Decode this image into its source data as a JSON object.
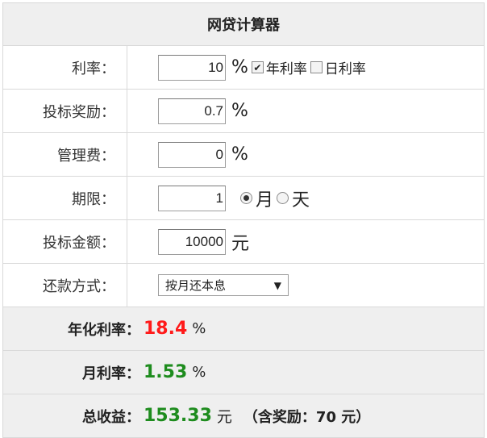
{
  "title": "网贷计算器",
  "rows": {
    "rate": {
      "label": "利率：",
      "value": "10",
      "unit": "%",
      "annual_label": "年利率",
      "daily_label": "日利率",
      "annual_checked": true,
      "daily_checked": false
    },
    "bonus": {
      "label": "投标奖励：",
      "value": "0.7",
      "unit": "%"
    },
    "fee": {
      "label": "管理费：",
      "value": "0",
      "unit": "%"
    },
    "term": {
      "label": "期限：",
      "value": "1",
      "month_label": "月",
      "day_label": "天",
      "selected": "月"
    },
    "amount": {
      "label": "投标金额：",
      "value": "10000",
      "unit": "元"
    },
    "repay": {
      "label": "还款方式：",
      "selected": "按月还本息"
    }
  },
  "results": {
    "annual": {
      "label": "年化利率：",
      "value": "18.4",
      "unit": "%"
    },
    "monthly": {
      "label": "月利率：",
      "value": "1.53",
      "unit": "%"
    },
    "total": {
      "label": "总收益：",
      "value": "153.33",
      "unit": "元",
      "bonus_note": "（含奖励：70 元）"
    }
  },
  "colors": {
    "accent_red": "#ff1a1a",
    "accent_green": "#1e8c1e",
    "panel_bg": "#efefef",
    "border": "#d9d9d9"
  }
}
